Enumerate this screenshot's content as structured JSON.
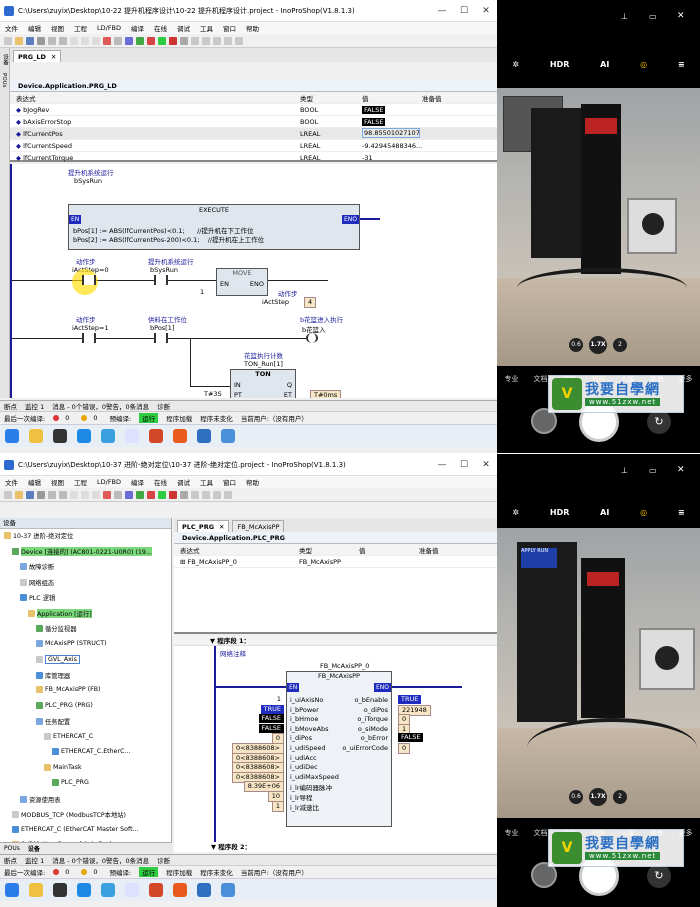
{
  "panel1": {
    "title": "C:\\Users\\zuyix\\Desktop\\10-22 提升机程序设计\\10-22 提升机程序设计.project - InoProShop(V1.8.1.3)",
    "menu": [
      "文件",
      "编辑",
      "视图",
      "工程",
      "LD/FBD",
      "编译",
      "在线",
      "调试",
      "工具",
      "窗口",
      "帮助"
    ],
    "side_labels": [
      "设备",
      "POUs"
    ],
    "tab": "PRG_LD",
    "path": "Device.Application.PRG_LD",
    "watch_headers": [
      "表达式",
      "类型",
      "值",
      "准备值"
    ],
    "watch_rows": [
      {
        "expr": "bJogRev",
        "type": "BOOL",
        "value": "FALSE"
      },
      {
        "expr": "bAxisErrorStop",
        "type": "BOOL",
        "value": "FALSE"
      },
      {
        "expr": "lfCurrentPos",
        "type": "LREAL",
        "value": "98.855010271070"
      },
      {
        "expr": "lfCurrentSpeed",
        "type": "LREAL",
        "value": "-9.42945488346..."
      },
      {
        "expr": "lfCurrentTorque",
        "type": "LREAL",
        "value": "-31"
      }
    ],
    "ld": {
      "top_comment": "提升机系统运行",
      "top_var": "bSysRun",
      "execute_title": "EXECUTE",
      "en": "EN",
      "eno": "ENO",
      "code_line1": "bPos[1] := ABS(lfCurrentPos)<0.1;",
      "code_cmt1": "//提升机在下工作位",
      "code_line2": "bPos[2] := ABS(lfCurrentPos-200)<0.1;",
      "code_cmt2": "//提升机在上工作位",
      "r1_c1_comment": "动作步",
      "r1_c1_var": "iActStep=0",
      "r1_c2_comment": "提升机系统运行",
      "r1_c2_var": "bSysRun",
      "move_title": "MOVE",
      "move_in": "1",
      "move_en": "EN",
      "move_eno": "ENO",
      "r1_out_comment": "动作步",
      "r1_out_var": "iActStep",
      "r1_out_val": "4",
      "r2_c1_comment": "动作步",
      "r2_c1_var": "iActStep=1",
      "r2_c2_comment": "供料在工作位",
      "r2_c2_var": "bPos[1]",
      "r2_coil_comment": "b花篮进入执行",
      "r2_coil_var": "b花篮入",
      "ton_comment": "花篮执行计数",
      "ton_var": "TON_Run[1]",
      "ton_title": "TON",
      "ton_in": "IN",
      "ton_q": "Q",
      "ton_pt": "PT",
      "ton_et": "ET",
      "ton_pt_val": "T#3S",
      "ton_et_val": "T#0ms"
    },
    "bottom_tabs": [
      "断点",
      "监控 1",
      "消息 - 0个错误，0警告，0条消息",
      "诊断"
    ],
    "status": {
      "compile": "最后一次编译:",
      "err": "0",
      "warn": "0",
      "pre": "预编译:",
      "run": "运行",
      "load": "程序加载",
      "change": "程序未变化",
      "user": "当前用户:（没有用户）"
    }
  },
  "panel2": {
    "title": "C:\\Users\\zuyix\\Desktop\\10-37 进阶-绝对定位\\10-37 进阶-绝对定位.project - InoProShop(V1.8.1.3)",
    "menu": [
      "文件",
      "编辑",
      "视图",
      "工程",
      "LD/FBD",
      "编译",
      "在线",
      "调试",
      "工具",
      "窗口",
      "帮助"
    ],
    "tree_title": "设备",
    "tree": [
      {
        "label": "10-37 进阶-绝对定位",
        "indent": 0
      },
      {
        "label": "Device [连接的] (AC801-0221-U0R0) (19...",
        "indent": 1,
        "hl": true
      },
      {
        "label": "故障诊断",
        "indent": 2
      },
      {
        "label": "网络组态",
        "indent": 2
      },
      {
        "label": "PLC 逻辑",
        "indent": 2
      },
      {
        "label": "Application [运行]",
        "indent": 3,
        "hl": true
      },
      {
        "label": "循分监视器",
        "indent": 4
      },
      {
        "label": "McAxisPP (STRUCT)",
        "indent": 4
      },
      {
        "label": "GVL_Axis",
        "indent": 4,
        "sel": true
      },
      {
        "label": "库管理器",
        "indent": 4
      },
      {
        "label": "FB_McAxisPP (FB)",
        "indent": 4
      },
      {
        "label": "PLC_PRG (PRG)",
        "indent": 4
      },
      {
        "label": "任务配置",
        "indent": 4
      },
      {
        "label": "ETHERCAT_C",
        "indent": 5
      },
      {
        "label": "ETHERCAT_C.EtherC...",
        "indent": 6
      },
      {
        "label": "MainTask",
        "indent": 5
      },
      {
        "label": "PLC_PRG",
        "indent": 6
      },
      {
        "label": "资源使用表",
        "indent": 2
      },
      {
        "label": "MODBUS_TCP (ModbusTCP本地站)",
        "indent": 1
      },
      {
        "label": "ETHERCAT_C (EtherCAT Master Soft...",
        "indent": 1
      },
      {
        "label": "SoftMotion General Axis Pool",
        "indent": 1
      }
    ],
    "tabs": [
      "PLC_PRG",
      "FB_McAxisPP"
    ],
    "path": "Device.Application.PLC_PRG",
    "watch_headers": [
      "表达式",
      "类型",
      "值",
      "准备值"
    ],
    "watch_rows": [
      {
        "expr": "FB_McAxisPP_0",
        "type": "FB_McAxisPP",
        "value": ""
      }
    ],
    "network1": "程序段 1：",
    "network_comment": "网络注释",
    "fb_inst": "FB_McAxisPP_0",
    "fb_type": "FB_McAxisPP",
    "en": "EN",
    "eno": "ENO",
    "inputs": [
      {
        "pin": "i_uiAxisNo",
        "val": "1"
      },
      {
        "pin": "i_bPower",
        "val": "TRUE"
      },
      {
        "pin": "i_bHmoe",
        "val": "FALSE"
      },
      {
        "pin": "i_bMoveAbs",
        "val": "FALSE"
      },
      {
        "pin": "i_diPos",
        "val": "0"
      },
      {
        "pin": "i_udiSpeed",
        "val": "0<8388608>"
      },
      {
        "pin": "i_udiAcc",
        "val": "0<8388608>"
      },
      {
        "pin": "i_udiDec",
        "val": "0<8388608>"
      },
      {
        "pin": "i_udiMaxSpeed",
        "val": "0<8388608>"
      },
      {
        "pin": "i_lr编码器脉冲",
        "val": "8.39E+06"
      },
      {
        "pin": "i_lr导程",
        "val": "10"
      },
      {
        "pin": "i_lr减速比",
        "val": "1"
      }
    ],
    "outputs": [
      {
        "pin": "o_bEnable",
        "val": "TRUE"
      },
      {
        "pin": "o_diPos",
        "val": "221948"
      },
      {
        "pin": "o_iTorque",
        "val": "0"
      },
      {
        "pin": "o_siMode",
        "val": "1"
      },
      {
        "pin": "o_bError",
        "val": "FALSE"
      },
      {
        "pin": "o_uiErrorCode",
        "val": "0"
      }
    ],
    "network2": "程序段 2：",
    "side_tabs": [
      "POUs",
      "设备"
    ],
    "bottom_tabs": [
      "断点",
      "监控 1",
      "消息 - 0个错误，0警告，0条消息",
      "诊断"
    ],
    "status": {
      "compile": "最后一次编译:",
      "err": "0",
      "warn": "0",
      "pre": "预编译:",
      "run": "运行",
      "load": "程序加载",
      "change": "程序未变化",
      "user": "当前用户:（没有用户）"
    }
  },
  "camera": {
    "top_icons": [
      "flash-icon",
      "HDR",
      "AI",
      "motion-icon",
      "menu-icon"
    ],
    "hdr": "HDR",
    "ai": "AI",
    "zoom": [
      "0.6",
      "1.7X",
      "2"
    ],
    "modes1": [
      "专业",
      "文档",
      "录像",
      "拍照",
      "人像",
      "夜景",
      "更多"
    ],
    "modes2": [
      "专业",
      "文档",
      "录像",
      "拍照",
      "人像",
      "夜景",
      "更多"
    ],
    "selected_mode": "拍照",
    "device_label": "APPLY RUN"
  },
  "watermark": {
    "title": "我要自學網",
    "url": "www.51zxw.net"
  }
}
